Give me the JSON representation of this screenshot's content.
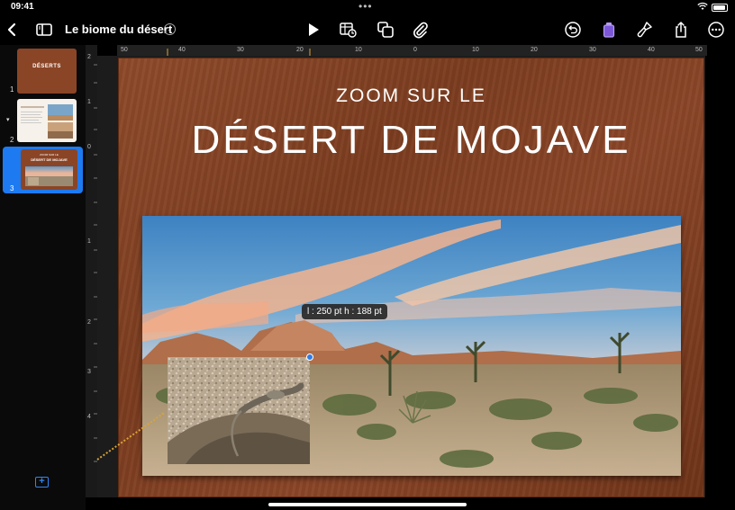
{
  "status": {
    "time": "09:41"
  },
  "toolbar": {
    "document_title": "Le biome du désert",
    "icons": [
      "back-chevron-icon",
      "sidebar-toggle-icon",
      "document-menu-chevron-icon",
      "play-icon",
      "table-chart-icon",
      "shapes-icon",
      "paperclip-icon",
      "undo-icon",
      "format-icon",
      "paintbrush-icon",
      "share-icon",
      "more-icon"
    ]
  },
  "slides": [
    {
      "number": "1",
      "title": "DÉSERTS"
    },
    {
      "number": "2",
      "title": ""
    },
    {
      "number": "3",
      "subtitle": "ZOOM SUR LE",
      "title": "DÉSERT DE MOJAVE",
      "selected": true
    }
  ],
  "ruler": {
    "horizontal": [
      "50",
      "40",
      "30",
      "20",
      "10",
      "0",
      "10",
      "20",
      "30",
      "40",
      "50"
    ],
    "vertical": [
      "2",
      "1",
      "0",
      "1",
      "2",
      "3",
      "4"
    ]
  },
  "slide": {
    "subtitle": "ZOOM SUR LE",
    "title": "DÉSERT DE MOJAVE"
  },
  "selection": {
    "size_label": "l : 250 pt  h : 188 pt"
  },
  "colors": {
    "accent": "#1d7af0",
    "slide_background": "#8a4527",
    "guide": "#d9a437"
  }
}
